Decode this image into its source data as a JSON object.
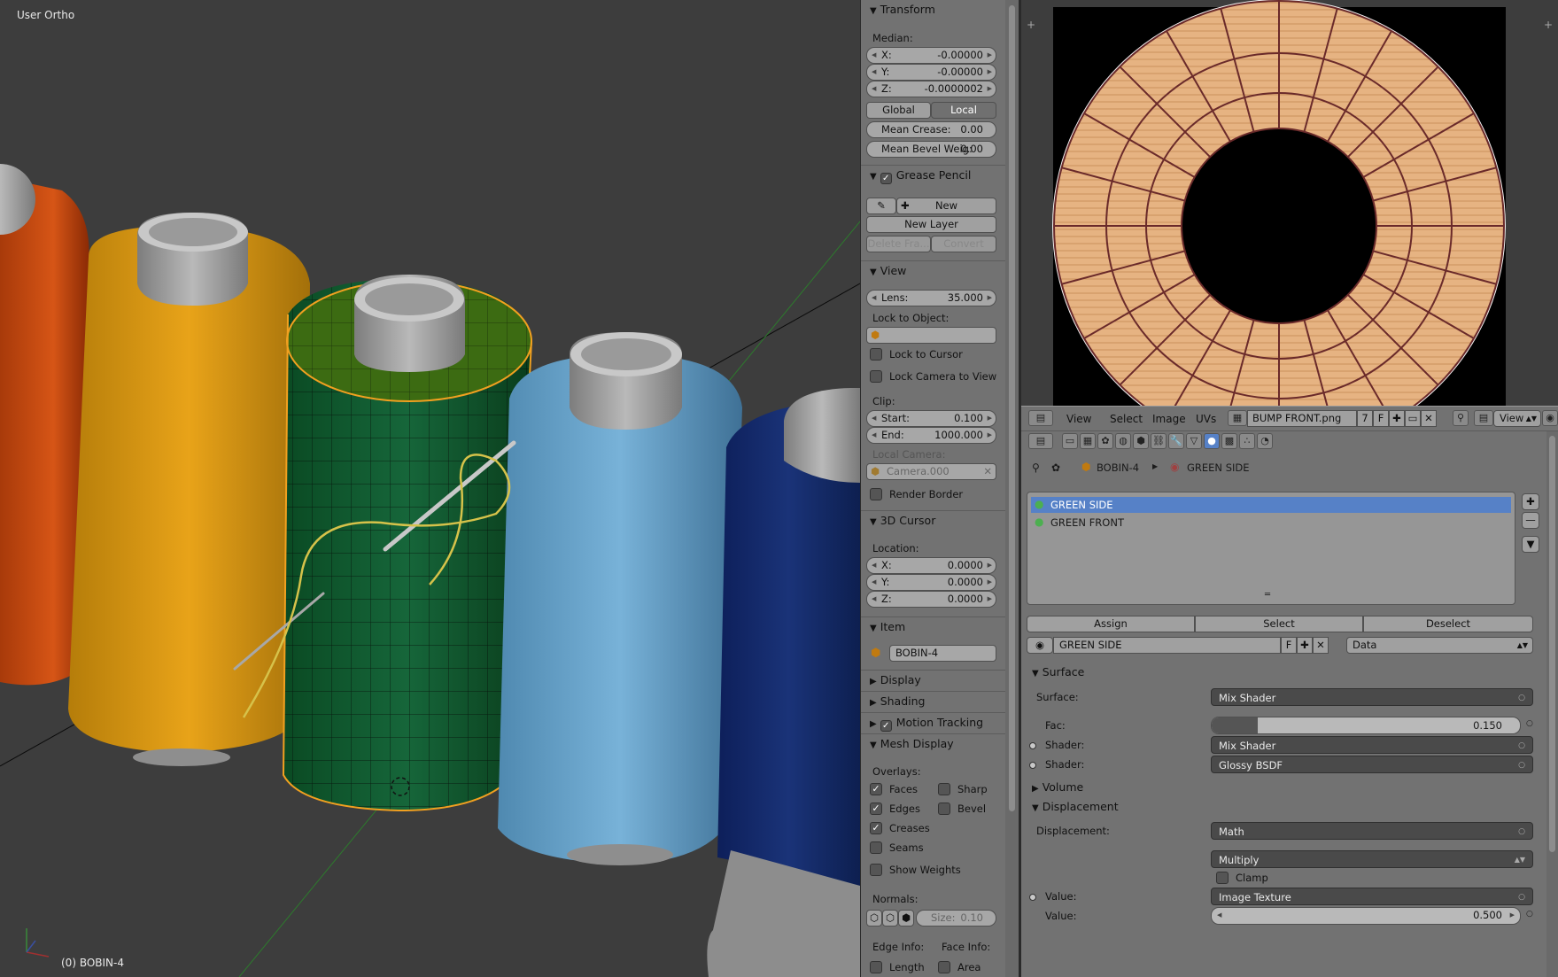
{
  "viewport": {
    "view_label": "User Ortho",
    "object_label": "(0) BOBIN-4"
  },
  "npanel": {
    "transform": {
      "title": "Transform",
      "median_label": "Median:",
      "x_label": "X:",
      "x_value": "-0.00000",
      "y_label": "Y:",
      "y_value": "-0.00000",
      "z_label": "Z:",
      "z_value": "-0.0000002",
      "global_label": "Global",
      "local_label": "Local",
      "crease_label": "Mean Crease:",
      "crease_value": "0.00",
      "bevel_label": "Mean Bevel Weig:",
      "bevel_value": "0.00"
    },
    "grease": {
      "title": "Grease Pencil",
      "new_label": "New",
      "new_layer_label": "New Layer",
      "delete_label": "Delete Fra...",
      "convert_label": "Convert"
    },
    "view": {
      "title": "View",
      "lens_label": "Lens:",
      "lens_value": "35.000",
      "lock_object_label": "Lock to Object:",
      "lock_cursor_label": "Lock to Cursor",
      "lock_camera_label": "Lock Camera to View",
      "clip_label": "Clip:",
      "start_label": "Start:",
      "start_value": "0.100",
      "end_label": "End:",
      "end_value": "1000.000",
      "local_camera_label": "Local Camera:",
      "camera_value": "Camera.000",
      "render_border_label": "Render Border"
    },
    "cursor": {
      "title": "3D Cursor",
      "location_label": "Location:",
      "x_label": "X:",
      "x_value": "0.0000",
      "y_label": "Y:",
      "y_value": "0.0000",
      "z_label": "Z:",
      "z_value": "0.0000"
    },
    "item": {
      "title": "Item",
      "name_value": "BOBIN-4"
    },
    "display_title": "Display",
    "shading_title": "Shading",
    "motion_title": "Motion Tracking",
    "mesh_display": {
      "title": "Mesh Display",
      "overlays_label": "Overlays:",
      "faces_label": "Faces",
      "sharp_label": "Sharp",
      "edges_label": "Edges",
      "bevel_label": "Bevel",
      "creases_label": "Creases",
      "seams_label": "Seams",
      "weights_label": "Show Weights",
      "normals_label": "Normals:",
      "size_label": "Size:",
      "size_value": "0.10",
      "edge_info_label": "Edge Info:",
      "face_info_label": "Face Info:",
      "length_label": "Length",
      "area_label": "Area"
    }
  },
  "uv_header": {
    "view_label": "View",
    "select_label": "Select",
    "image_label": "Image",
    "uvs_label": "UVs",
    "image_name": "BUMP FRONT.png",
    "users_count": "7",
    "fake_user": "F",
    "view_mode": "View"
  },
  "properties": {
    "breadcrumb_object": "BOBIN-4",
    "breadcrumb_material": "GREEN SIDE",
    "slots": [
      "GREEN SIDE",
      "GREEN FRONT"
    ],
    "assign_label": "Assign",
    "select_label": "Select",
    "deselect_label": "Deselect",
    "material_name": "GREEN SIDE",
    "fake_user": "F",
    "link_value": "Data",
    "surface_title": "Surface",
    "surface_label": "Surface:",
    "surface_value": "Mix Shader",
    "fac_label": "Fac:",
    "fac_value": "0.150",
    "fac_fraction": 0.15,
    "shader1_label": "Shader:",
    "shader1_value": "Mix Shader",
    "shader2_label": "Shader:",
    "shader2_value": "Glossy BSDF",
    "volume_title": "Volume",
    "displacement_title": "Displacement",
    "displacement_label": "Displacement:",
    "displacement_value": "Math",
    "operation_value": "Multiply",
    "clamp_label": "Clamp",
    "value1_label": "Value:",
    "value1_value": "Image Texture",
    "value2_label": "Value:",
    "value2_value": "0.500"
  },
  "colors": {
    "selection": "#5681c7",
    "panel": "#727272",
    "viewport": "#3d3d3d"
  }
}
